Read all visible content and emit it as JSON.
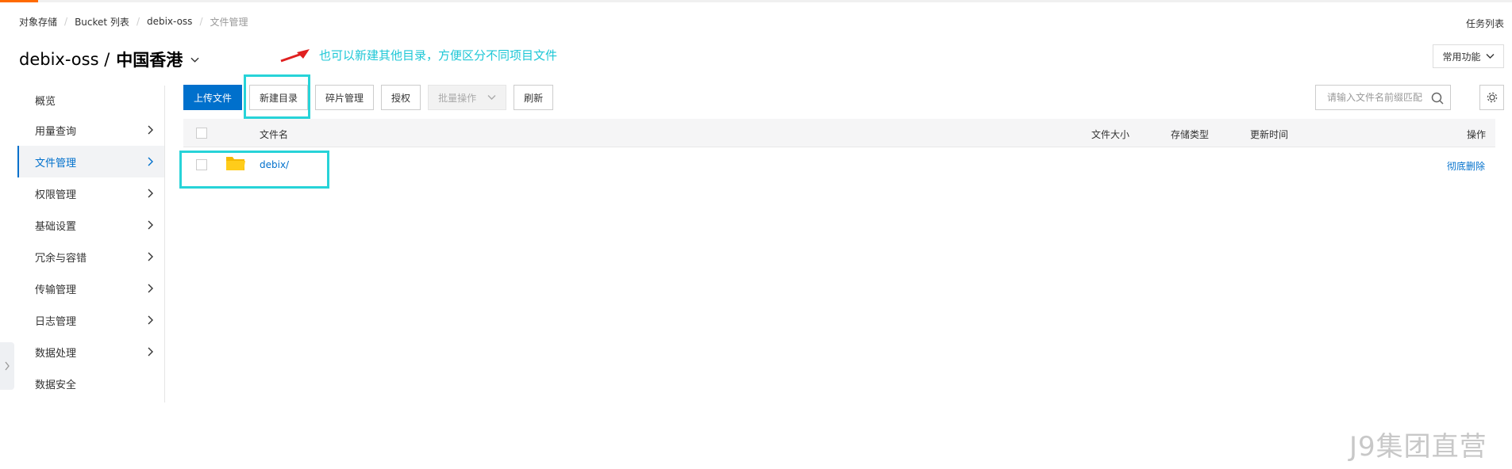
{
  "breadcrumb": [
    "对象存储",
    "Bucket 列表",
    "debix-oss",
    "文件管理"
  ],
  "task_list_label": "任务列表",
  "title": {
    "bucket": "debix-oss /",
    "region": "中国香港"
  },
  "annotation": "也可以新建其他目录，方便区分不同项目文件",
  "common_functions_label": "常用功能",
  "sidebar": {
    "items": [
      {
        "label": "概览"
      },
      {
        "label": "用量查询"
      },
      {
        "label": "文件管理"
      },
      {
        "label": "权限管理"
      },
      {
        "label": "基础设置"
      },
      {
        "label": "冗余与容错"
      },
      {
        "label": "传输管理"
      },
      {
        "label": "日志管理"
      },
      {
        "label": "数据处理"
      },
      {
        "label": "数据安全"
      }
    ]
  },
  "toolbar": {
    "upload": "上传文件",
    "new_dir": "新建目录",
    "fragments": "碎片管理",
    "authorize": "授权",
    "batch": "批量操作",
    "refresh": "刷新"
  },
  "search": {
    "placeholder": "请输入文件名前缀匹配"
  },
  "table": {
    "headers": {
      "name": "文件名",
      "size": "文件大小",
      "storage": "存储类型",
      "updated": "更新时间",
      "ops": "操作"
    },
    "rows": [
      {
        "name": "debix/",
        "op": "彻底删除"
      }
    ]
  },
  "watermark": "J9集团直营",
  "colors": {
    "primary": "#0070cc",
    "annotation": "#1ec7d6",
    "highlight": "#27d3d8",
    "accent": "#ff6a00"
  }
}
